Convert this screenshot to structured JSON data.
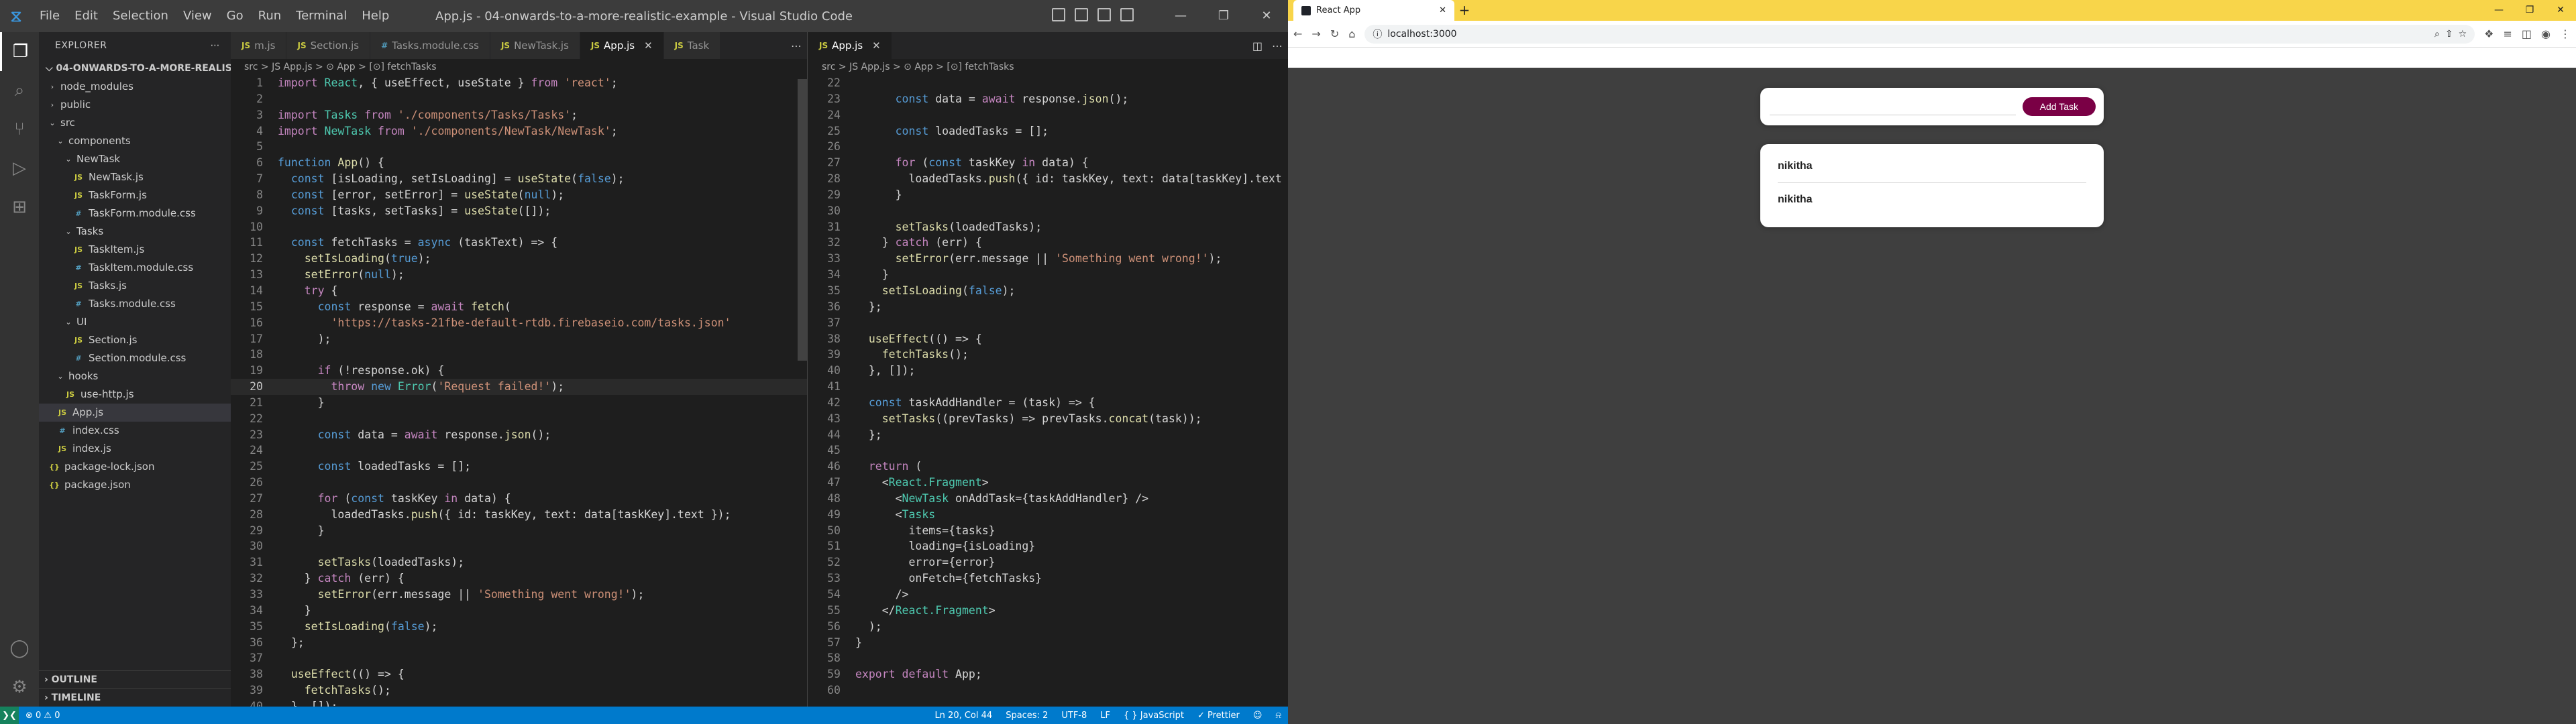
{
  "vscode": {
    "menu": [
      "File",
      "Edit",
      "Selection",
      "View",
      "Go",
      "Run",
      "Terminal",
      "Help"
    ],
    "title": "App.js - 04-onwards-to-a-more-realistic-example - Visual Studio Code",
    "explorer": {
      "header": "EXPLORER",
      "project": "04-ONWARDS-TO-A-MORE-REALISTI...",
      "tree": [
        {
          "label": "node_modules",
          "type": "folder",
          "depth": 1,
          "open": false
        },
        {
          "label": "public",
          "type": "folder",
          "depth": 1,
          "open": false
        },
        {
          "label": "src",
          "type": "folder",
          "depth": 1,
          "open": true
        },
        {
          "label": "components",
          "type": "folder",
          "depth": 2,
          "open": true
        },
        {
          "label": "NewTask",
          "type": "folder",
          "depth": 3,
          "open": true
        },
        {
          "label": "NewTask.js",
          "type": "js",
          "depth": 4
        },
        {
          "label": "TaskForm.js",
          "type": "js",
          "depth": 4
        },
        {
          "label": "TaskForm.module.css",
          "type": "css",
          "depth": 4
        },
        {
          "label": "Tasks",
          "type": "folder",
          "depth": 3,
          "open": true
        },
        {
          "label": "TaskItem.js",
          "type": "js",
          "depth": 4
        },
        {
          "label": "TaskItem.module.css",
          "type": "css",
          "depth": 4
        },
        {
          "label": "Tasks.js",
          "type": "js",
          "depth": 4
        },
        {
          "label": "Tasks.module.css",
          "type": "css",
          "depth": 4
        },
        {
          "label": "UI",
          "type": "folder",
          "depth": 3,
          "open": true
        },
        {
          "label": "Section.js",
          "type": "js",
          "depth": 4
        },
        {
          "label": "Section.module.css",
          "type": "css",
          "depth": 4
        },
        {
          "label": "hooks",
          "type": "folder",
          "depth": 2,
          "open": true
        },
        {
          "label": "use-http.js",
          "type": "js",
          "depth": 3
        },
        {
          "label": "App.js",
          "type": "js",
          "depth": 2,
          "selected": true
        },
        {
          "label": "index.css",
          "type": "css",
          "depth": 2
        },
        {
          "label": "index.js",
          "type": "js",
          "depth": 2
        },
        {
          "label": "package-lock.json",
          "type": "json",
          "depth": 1
        },
        {
          "label": "package.json",
          "type": "json",
          "depth": 1
        }
      ],
      "outline": "OUTLINE",
      "timeline": "TIMELINE"
    },
    "left_tabs": [
      {
        "label": "m.js",
        "type": "js"
      },
      {
        "label": "Section.js",
        "type": "js"
      },
      {
        "label": "Tasks.module.css",
        "type": "css"
      },
      {
        "label": "NewTask.js",
        "type": "js"
      },
      {
        "label": "App.js",
        "type": "js",
        "active": true
      },
      {
        "label": "Task",
        "type": "js"
      }
    ],
    "right_tabs": [
      {
        "label": "App.js",
        "type": "js",
        "active": true
      }
    ],
    "left_crumbs": "src > JS App.js > ⊙ App > [⊙] fetchTasks",
    "right_crumbs": "src > JS App.js > ⊙ App > [⊙] fetchTasks",
    "status": {
      "errors": "⊗ 0 ⚠ 0",
      "position": "Ln 20, Col 44",
      "spaces": "Spaces: 2",
      "encoding": "UTF-8",
      "eol": "LF",
      "language": "{ } JavaScript",
      "prettier": "✓ Prettier"
    }
  },
  "left_code": [
    {
      "n": "1",
      "t": "import React, { useEffect, useState } from 'react';"
    },
    {
      "n": "2",
      "t": ""
    },
    {
      "n": "3",
      "t": "import Tasks from './components/Tasks/Tasks';"
    },
    {
      "n": "4",
      "t": "import NewTask from './components/NewTask/NewTask';"
    },
    {
      "n": "5",
      "t": ""
    },
    {
      "n": "6",
      "t": "function App() {"
    },
    {
      "n": "7",
      "t": "  const [isLoading, setIsLoading] = useState(false);"
    },
    {
      "n": "8",
      "t": "  const [error, setError] = useState(null);"
    },
    {
      "n": "9",
      "t": "  const [tasks, setTasks] = useState([]);"
    },
    {
      "n": "10",
      "t": ""
    },
    {
      "n": "11",
      "t": "  const fetchTasks = async (taskText) => {"
    },
    {
      "n": "12",
      "t": "    setIsLoading(true);"
    },
    {
      "n": "13",
      "t": "    setError(null);"
    },
    {
      "n": "14",
      "t": "    try {"
    },
    {
      "n": "15",
      "t": "      const response = await fetch("
    },
    {
      "n": "16",
      "t": "        'https://tasks-21fbe-default-rtdb.firebaseio.com/tasks.json'"
    },
    {
      "n": "17",
      "t": "      );"
    },
    {
      "n": "18",
      "t": ""
    },
    {
      "n": "19",
      "t": "      if (!response.ok) {"
    },
    {
      "n": "20",
      "t": "        throw new Error('Request failed!');",
      "cur": true
    },
    {
      "n": "21",
      "t": "      }"
    },
    {
      "n": "22",
      "t": ""
    },
    {
      "n": "23",
      "t": "      const data = await response.json();"
    },
    {
      "n": "24",
      "t": ""
    },
    {
      "n": "25",
      "t": "      const loadedTasks = [];"
    },
    {
      "n": "26",
      "t": ""
    },
    {
      "n": "27",
      "t": "      for (const taskKey in data) {"
    },
    {
      "n": "28",
      "t": "        loadedTasks.push({ id: taskKey, text: data[taskKey].text });"
    },
    {
      "n": "29",
      "t": "      }"
    },
    {
      "n": "30",
      "t": ""
    },
    {
      "n": "31",
      "t": "      setTasks(loadedTasks);"
    },
    {
      "n": "32",
      "t": "    } catch (err) {"
    },
    {
      "n": "33",
      "t": "      setError(err.message || 'Something went wrong!');"
    },
    {
      "n": "34",
      "t": "    }"
    },
    {
      "n": "35",
      "t": "    setIsLoading(false);"
    },
    {
      "n": "36",
      "t": "  };"
    },
    {
      "n": "37",
      "t": ""
    },
    {
      "n": "38",
      "t": "  useEffect(() => {"
    },
    {
      "n": "39",
      "t": "    fetchTasks();"
    },
    {
      "n": "40",
      "t": "  }, []);"
    }
  ],
  "right_code": [
    {
      "n": "22",
      "t": ""
    },
    {
      "n": "23",
      "t": "      const data = await response.json();"
    },
    {
      "n": "24",
      "t": ""
    },
    {
      "n": "25",
      "t": "      const loadedTasks = [];"
    },
    {
      "n": "26",
      "t": ""
    },
    {
      "n": "27",
      "t": "      for (const taskKey in data) {"
    },
    {
      "n": "28",
      "t": "        loadedTasks.push({ id: taskKey, text: data[taskKey].text });"
    },
    {
      "n": "29",
      "t": "      }"
    },
    {
      "n": "30",
      "t": ""
    },
    {
      "n": "31",
      "t": "      setTasks(loadedTasks);"
    },
    {
      "n": "32",
      "t": "    } catch (err) {"
    },
    {
      "n": "33",
      "t": "      setError(err.message || 'Something went wrong!');"
    },
    {
      "n": "34",
      "t": "    }"
    },
    {
      "n": "35",
      "t": "    setIsLoading(false);"
    },
    {
      "n": "36",
      "t": "  };"
    },
    {
      "n": "37",
      "t": ""
    },
    {
      "n": "38",
      "t": "  useEffect(() => {"
    },
    {
      "n": "39",
      "t": "    fetchTasks();"
    },
    {
      "n": "40",
      "t": "  }, []);"
    },
    {
      "n": "41",
      "t": ""
    },
    {
      "n": "42",
      "t": "  const taskAddHandler = (task) => {"
    },
    {
      "n": "43",
      "t": "    setTasks((prevTasks) => prevTasks.concat(task));"
    },
    {
      "n": "44",
      "t": "  };"
    },
    {
      "n": "45",
      "t": ""
    },
    {
      "n": "46",
      "t": "  return ("
    },
    {
      "n": "47",
      "t": "    <React.Fragment>"
    },
    {
      "n": "48",
      "t": "      <NewTask onAddTask={taskAddHandler} />"
    },
    {
      "n": "49",
      "t": "      <Tasks"
    },
    {
      "n": "50",
      "t": "        items={tasks}"
    },
    {
      "n": "51",
      "t": "        loading={isLoading}"
    },
    {
      "n": "52",
      "t": "        error={error}"
    },
    {
      "n": "53",
      "t": "        onFetch={fetchTasks}"
    },
    {
      "n": "54",
      "t": "      />"
    },
    {
      "n": "55",
      "t": "    </React.Fragment>"
    },
    {
      "n": "56",
      "t": "  );"
    },
    {
      "n": "57",
      "t": "}"
    },
    {
      "n": "58",
      "t": ""
    },
    {
      "n": "59",
      "t": "export default App;"
    },
    {
      "n": "60",
      "t": ""
    }
  ],
  "browser": {
    "tab_title": "React App",
    "url": "localhost:3000",
    "add_task_label": "Add Task",
    "tasks": [
      "nikitha",
      "nikitha"
    ]
  }
}
